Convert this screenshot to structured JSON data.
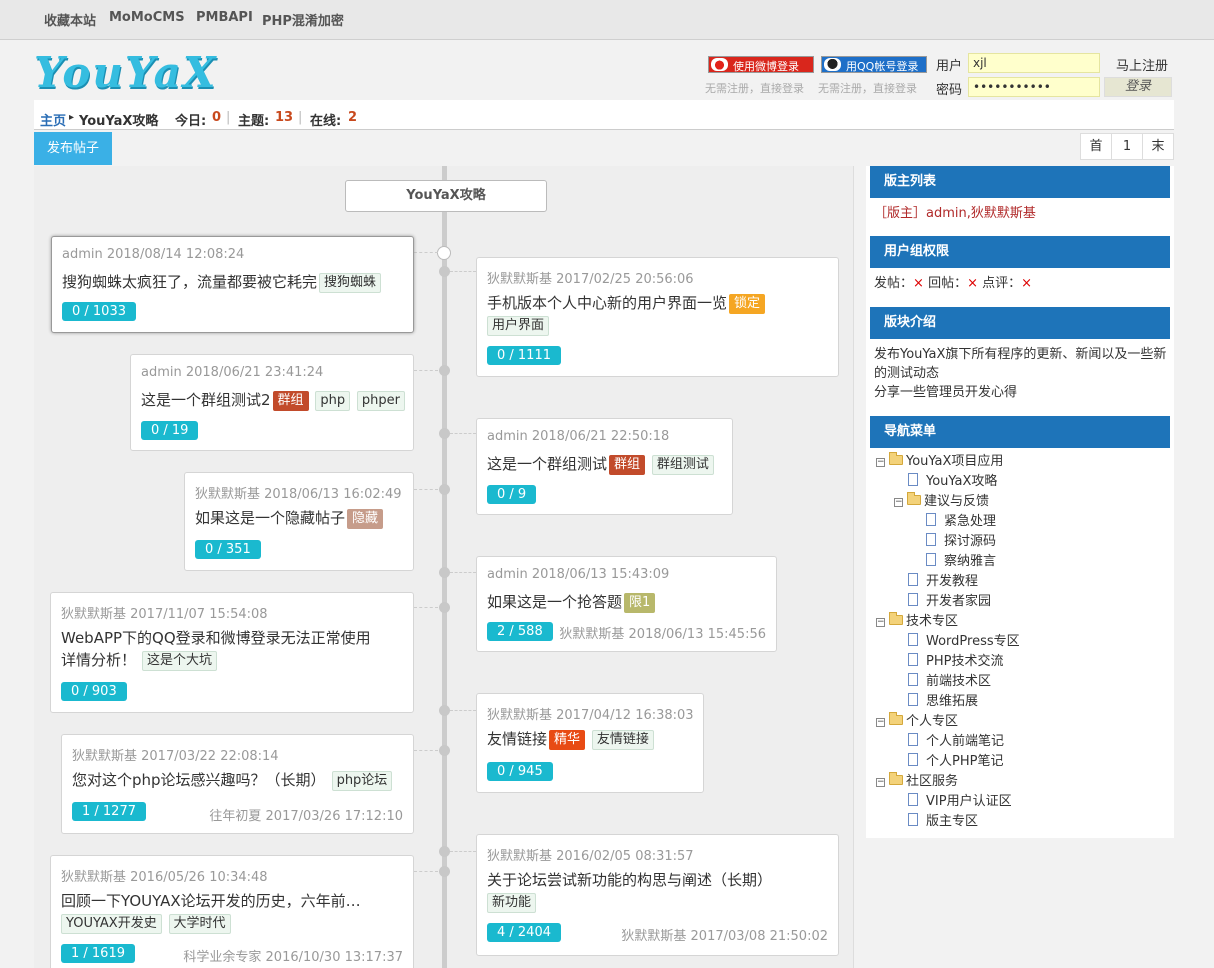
{
  "topbar": {
    "links": [
      "收藏本站",
      "MoMoCMS",
      "PMBAPI",
      "PHP混淆加密"
    ]
  },
  "logo": {
    "text": "YouYaX"
  },
  "login": {
    "weibo_label": "使用微博登录",
    "qq_label": "用QQ帐号登录",
    "weibo_note": "无需注册，直接登录",
    "qq_note": "无需注册，直接登录",
    "user_label": "用户",
    "user_value": "xjl",
    "pass_label": "密码",
    "pass_value": "•••••••••••",
    "register_label": "马上注册",
    "submit_label": "登录"
  },
  "breadcrumb": {
    "home": "主页",
    "arrow": "▸",
    "current": "YouYaX攻略",
    "today_label": "今日:",
    "today_value": "0",
    "topics_label": "主题:",
    "topics_value": "13",
    "online_label": "在线:",
    "online_value": "2",
    "separator": "|"
  },
  "toolbar": {
    "post_label": "发布帖子"
  },
  "pager": {
    "first": "首",
    "page": "1",
    "last": "末"
  },
  "timeline": {
    "forum_title": "YouYaX攻略",
    "posts": [
      {
        "meta": "admin   2018/08/14 12:08:24",
        "title": "搜狗蜘蛛太疯狂了，流量都要被它耗完",
        "tags": [
          "搜狗蜘蛛"
        ],
        "stat": "0 / 1033",
        "last": ""
      },
      {
        "meta": "狄默默斯基   2017/02/25 20:56:06",
        "title": "手机版本个人中心新的用户界面一览",
        "tags": [
          "锁定",
          "用户界面"
        ],
        "stat": "0 / 1111",
        "last": ""
      },
      {
        "meta": "admin   2018/06/21 23:41:24",
        "title": "这是一个群组测试2",
        "tags": [
          "群组",
          "php",
          "phper"
        ],
        "stat": "0 / 19",
        "last": ""
      },
      {
        "meta": "admin   2018/06/21 22:50:18",
        "title": "这是一个群组测试",
        "tags": [
          "群组",
          "群组测试"
        ],
        "stat": "0 / 9",
        "last": ""
      },
      {
        "meta": "狄默默斯基   2018/06/13 16:02:49",
        "title": "如果这是一个隐藏帖子",
        "tags": [
          "隐藏"
        ],
        "stat": "0 / 351",
        "last": ""
      },
      {
        "meta": "admin   2018/06/13 15:43:09",
        "title": "如果这是一个抢答题",
        "tags": [
          "限1"
        ],
        "stat": "2 / 588",
        "last": "狄默默斯基   2018/06/13 15:45:56"
      },
      {
        "meta": "狄默默斯基   2017/11/07 15:54:08",
        "title": "WebAPP下的QQ登录和微博登录无法正常使用",
        "title2": "详情分析！",
        "tags": [
          "这是个大坑"
        ],
        "stat": "0 / 903",
        "last": ""
      },
      {
        "meta": "狄默默斯基   2017/04/12 16:38:03",
        "title": "友情链接",
        "tags": [
          "精华",
          "友情链接"
        ],
        "stat": "0 / 945",
        "last": ""
      },
      {
        "meta": "狄默默斯基   2017/03/22 22:08:14",
        "title": "您对这个php论坛感兴趣吗？（长期）",
        "tags": [
          "php论坛"
        ],
        "stat": "1 / 1277",
        "last": "往年初夏   2017/03/26 17:12:10"
      },
      {
        "meta": "狄默默斯基   2016/02/05 08:31:57",
        "title": "关于论坛尝试新功能的构思与阐述（长期）",
        "tags": [
          "新功能"
        ],
        "stat": "4 / 2404",
        "last": "狄默默斯基   2017/03/08 21:50:02"
      },
      {
        "meta": "狄默默斯基   2016/05/26 10:34:48",
        "title": "回顾一下YOUYAX论坛开发的历史，六年前…",
        "tags": [
          "YOUYAX开发史",
          "大学时代"
        ],
        "stat": "1 / 1619",
        "last": "科学业余专家   2016/10/30 13:17:37"
      }
    ]
  },
  "sidebar": {
    "moderators_title": "版主列表",
    "moderators_text": "［版主］admin,狄默默斯基",
    "perm_title": "用户组权限",
    "perm_post": "发帖：",
    "perm_reply": "回帖：",
    "perm_comment": "点评：",
    "perm_mark": "×",
    "intro_title": "版块介绍",
    "intro_text1": "发布YouYaX旗下所有程序的更新、新闻以及一些新的测试动态",
    "intro_text2": "分享一些管理员开发心得",
    "nav_title": "导航菜单",
    "tree": [
      {
        "label": "YouYaX项目应用",
        "type": "folder",
        "level": 0
      },
      {
        "label": "YouYaX攻略",
        "type": "doc",
        "level": 1
      },
      {
        "label": "建议与反馈",
        "type": "folder",
        "level": 1
      },
      {
        "label": "紧急处理",
        "type": "doc",
        "level": 2
      },
      {
        "label": "探讨源码",
        "type": "doc",
        "level": 2
      },
      {
        "label": "察纳雅言",
        "type": "doc",
        "level": 2
      },
      {
        "label": "开发教程",
        "type": "doc",
        "level": 1
      },
      {
        "label": "开发者家园",
        "type": "doc",
        "level": 1
      },
      {
        "label": "技术专区",
        "type": "folder",
        "level": 0
      },
      {
        "label": "WordPress专区",
        "type": "doc",
        "level": 1
      },
      {
        "label": "PHP技术交流",
        "type": "doc",
        "level": 1
      },
      {
        "label": "前端技术区",
        "type": "doc",
        "level": 1
      },
      {
        "label": "思维拓展",
        "type": "doc",
        "level": 1
      },
      {
        "label": "个人专区",
        "type": "folder",
        "level": 0
      },
      {
        "label": "个人前端笔记",
        "type": "doc",
        "level": 1
      },
      {
        "label": "个人PHP笔记",
        "type": "doc",
        "level": 1
      },
      {
        "label": "社区服务",
        "type": "folder",
        "level": 0
      },
      {
        "label": "VIP用户认证区",
        "type": "doc",
        "level": 1
      },
      {
        "label": "版主专区",
        "type": "doc",
        "level": 1
      }
    ]
  },
  "colors": {
    "accent": "#1e74b9",
    "stat_badge": "#1ab9cf",
    "post_button": "#3ab0e6",
    "count": "#c8491d"
  },
  "icons": {
    "weibo": "weibo-icon",
    "qq": "qq-icon",
    "folder": "folder-icon",
    "doc": "document-icon",
    "tree_toggle": "collapse-icon"
  }
}
